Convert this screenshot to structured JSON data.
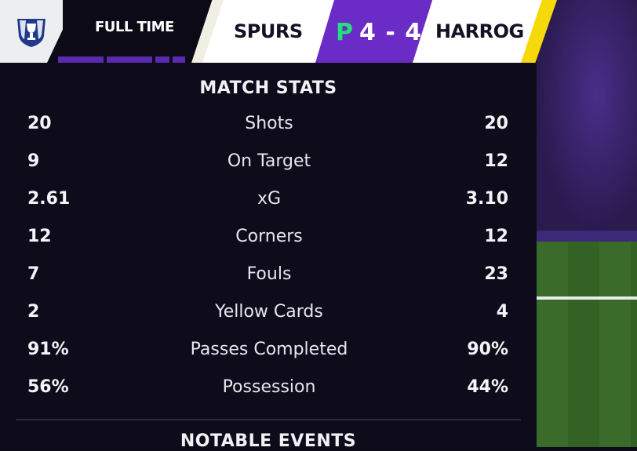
{
  "header": {
    "crest_icon": "trophy-shield-icon",
    "status": "FULL TIME",
    "home_team": "SPURS",
    "score_prefix": "P",
    "score": "4 - 4",
    "away_team": "HARROG",
    "colors": {
      "home_accent": "#f0efe4",
      "away_accent": "#f5d90a",
      "score_bg": "#6b2bc7",
      "score_prefix": "#22e07a"
    }
  },
  "stats": {
    "title": "MATCH STATS",
    "rows": [
      {
        "label": "Shots",
        "home": "20",
        "away": "20"
      },
      {
        "label": "On Target",
        "home": "9",
        "away": "12"
      },
      {
        "label": "xG",
        "home": "2.61",
        "away": "3.10"
      },
      {
        "label": "Corners",
        "home": "12",
        "away": "12"
      },
      {
        "label": "Fouls",
        "home": "7",
        "away": "23"
      },
      {
        "label": "Yellow Cards",
        "home": "2",
        "away": "4"
      },
      {
        "label": "Passes Completed",
        "home": "91%",
        "away": "90%"
      },
      {
        "label": "Possession",
        "home": "56%",
        "away": "44%"
      }
    ]
  },
  "events": {
    "title": "NOTABLE EVENTS"
  }
}
